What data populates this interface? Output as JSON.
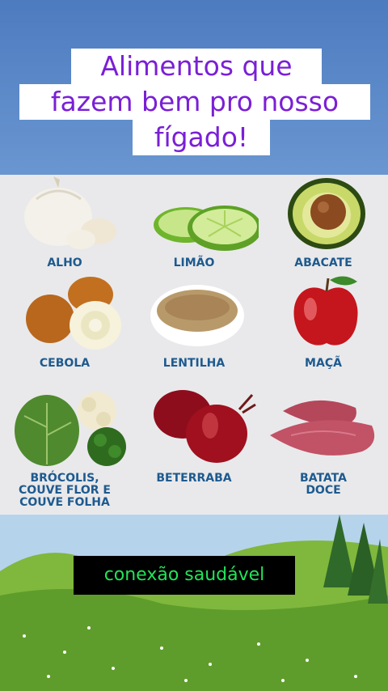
{
  "title": {
    "line1": "Alimentos que",
    "line2": "fazem bem pro nosso",
    "line3": "fígado!"
  },
  "foods": [
    {
      "label": "ALHO",
      "icon": "garlic-icon"
    },
    {
      "label": "LIMÃO",
      "icon": "lime-icon"
    },
    {
      "label": "ABACATE",
      "icon": "avocado-icon"
    },
    {
      "label": "CEBOLA",
      "icon": "onion-icon"
    },
    {
      "label": "LENTILHA",
      "icon": "lentil-icon"
    },
    {
      "label": "MAÇÃ",
      "icon": "apple-icon"
    },
    {
      "label": "BRÓCOLIS,\nCOUVE FLOR E\nCOUVE FOLHA",
      "icon": "broccoli-icon"
    },
    {
      "label": "BETERRABA",
      "icon": "beet-icon"
    },
    {
      "label": "BATATA\nDOCE",
      "icon": "sweet-potato-icon"
    }
  ],
  "caption": "conexão saudável",
  "colors": {
    "title": "#7a1fd6",
    "label": "#1e5a8f",
    "caption_text": "#22e35a"
  }
}
